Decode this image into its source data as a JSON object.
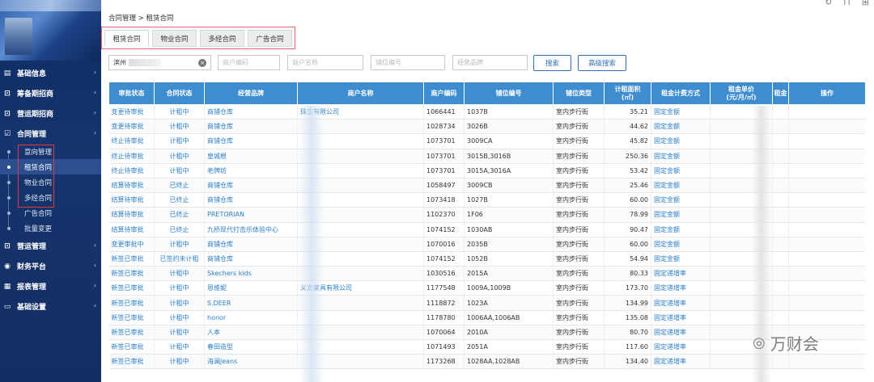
{
  "sidebar": {
    "menu": [
      {
        "label": "基础信息",
        "icon": "info-icon"
      },
      {
        "label": "筹备期招商",
        "icon": "cart-icon"
      },
      {
        "label": "营运期招商",
        "icon": "cart-icon"
      },
      {
        "label": "合同管理",
        "icon": "contract-icon"
      }
    ],
    "sub_items": [
      "意向管理",
      "租赁合同",
      "物业合同",
      "多经合同",
      "广告合同",
      "批量变更"
    ],
    "menu_after": [
      {
        "label": "营运管理",
        "icon": "cart-icon"
      },
      {
        "label": "财务平台",
        "icon": "money-icon"
      },
      {
        "label": "报表管理",
        "icon": "chart-icon"
      },
      {
        "label": "基础设置",
        "icon": "folder-icon"
      }
    ]
  },
  "breadcrumb": "合同管理 > 租赁合同",
  "tabs": [
    "租赁合同",
    "物业合同",
    "多经合同",
    "广告合同"
  ],
  "filters": {
    "project_value": "滨州",
    "placeholders": [
      "商户编码",
      "商户名称",
      "铺位编号",
      "经营品牌"
    ],
    "search_label": "搜索",
    "advanced_label": "高级搜索"
  },
  "table": {
    "columns": [
      "审批状态",
      "合同状态",
      "经营品牌",
      "商户名称",
      "商户编码",
      "铺位编号",
      "铺位类型",
      "计租面积\n(㎡)",
      "租金计费方式",
      "租金单价\n(元/月/㎡)",
      "租金",
      "操作"
    ],
    "rows": [
      [
        "变更待审批",
        "计租中",
        "商铺仓库",
        "珠宝有限公司",
        "1066441",
        "1037B",
        "室内步行街",
        "35.21",
        "固定金额"
      ],
      [
        "变更待审批",
        "计租中",
        "商铺仓库",
        "",
        "1028734",
        "3026B",
        "室内步行街",
        "44.62",
        "固定金额"
      ],
      [
        "终止待审批",
        "计租中",
        "商铺仓库",
        "",
        "1073701",
        "3009CA",
        "室内步行街",
        "45.82",
        "固定金额"
      ],
      [
        "终止待审批",
        "计租中",
        "皇城根",
        "",
        "1073701",
        "3015B,3016B",
        "室内步行街",
        "250.36",
        "固定金额"
      ],
      [
        "终止待审批",
        "计租中",
        "老牌坊",
        "",
        "1073701",
        "3015A,3016A",
        "室内步行街",
        "53.42",
        "固定金额"
      ],
      [
        "结算待审批",
        "已终止",
        "商铺仓库",
        "",
        "1058497",
        "3009CB",
        "室内步行街",
        "25.46",
        "固定金额"
      ],
      [
        "结算待审批",
        "已终止",
        "商铺仓库",
        "",
        "1073418",
        "1027B",
        "室内步行街",
        "60.00",
        "固定金额"
      ],
      [
        "结算待审批",
        "已终止",
        "PRETORIAN",
        "",
        "1102370",
        "1F06",
        "室内步行街",
        "78.99",
        "固定金额"
      ],
      [
        "结算待审批",
        "已终止",
        "九桥现代打击乐体验中心",
        "",
        "1074152",
        "1030AB",
        "室内步行街",
        "90.47",
        "固定金额"
      ],
      [
        "变更审批中",
        "计租中",
        "商铺仓库",
        "",
        "1070016",
        "2035B",
        "室内步行街",
        "60.00",
        "固定金额"
      ],
      [
        "新签已审批",
        "已签约未计租",
        "商铺仓库",
        "",
        "1074152",
        "1052B",
        "室内步行街",
        "54.94",
        "固定金额"
      ],
      [
        "新签已审批",
        "计租中",
        "Skechers kids",
        "",
        "1030516",
        "2015A",
        "室内步行街",
        "80.33",
        "固定递增率"
      ],
      [
        "新签已审批",
        "计租中",
        "恩维妮",
        "义龙家具有限公司",
        "1177548",
        "1009A,1009B",
        "室内步行街",
        "173.70",
        "固定递增率"
      ],
      [
        "新签已审批",
        "计租中",
        "S.DEER",
        "",
        "1118872",
        "1023A",
        "室内步行街",
        "134.99",
        "固定递增率"
      ],
      [
        "新签已审批",
        "计租中",
        "honor",
        "",
        "1178780",
        "1006AA,1006AB",
        "室内步行街",
        "135.08",
        "固定递增率"
      ],
      [
        "新签已审批",
        "计租中",
        "人本",
        "",
        "1070064",
        "2010A",
        "室内步行街",
        "80.70",
        "固定递增率"
      ],
      [
        "新签已审批",
        "计租中",
        "春田造型",
        "",
        "1071493",
        "2051A",
        "室内步行街",
        "117.60",
        "固定递增率"
      ],
      [
        "新签已审批",
        "计租中",
        "海澜jeans",
        "",
        "1173268",
        "1028AA,1028AB",
        "室内步行街",
        "134.40",
        "固定递增率"
      ]
    ]
  },
  "watermark": "万财会"
}
